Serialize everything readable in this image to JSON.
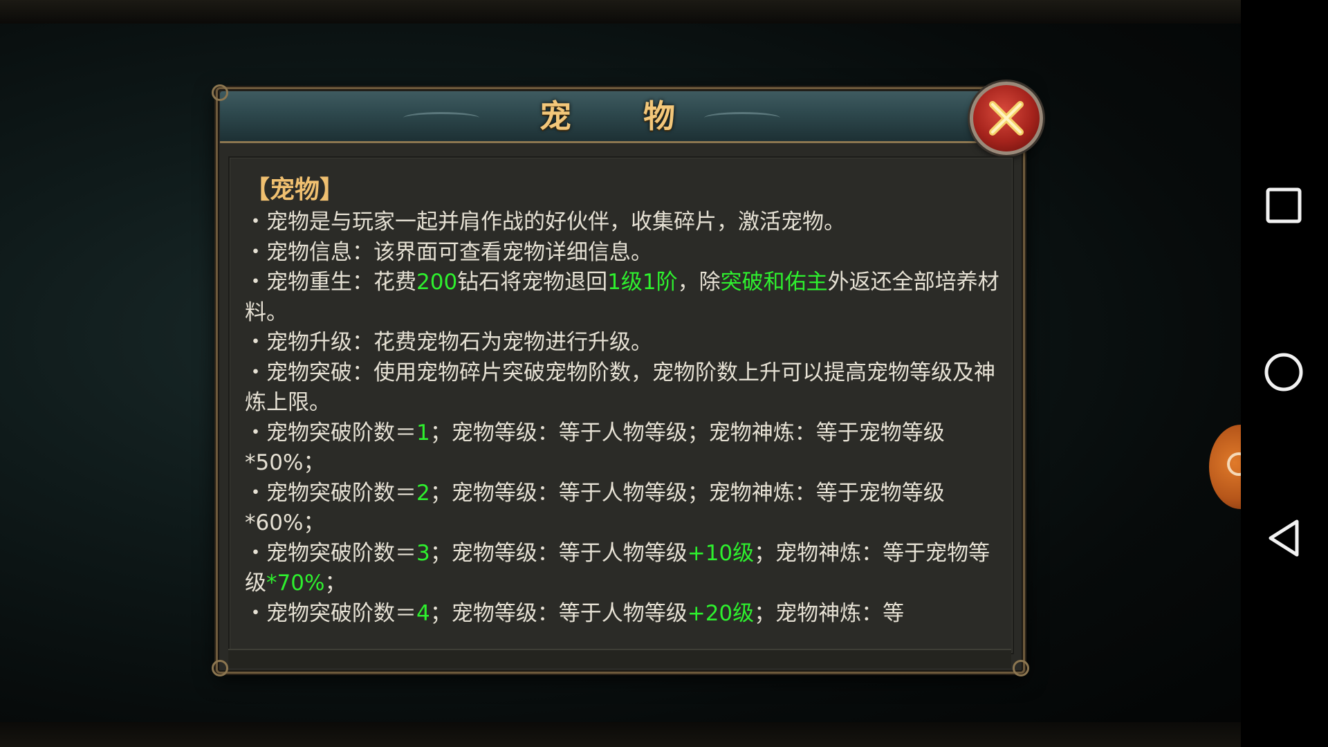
{
  "dialog": {
    "title": "宠  物",
    "close_label": "close",
    "section_title": "【宠物】",
    "lines": [
      [
        {
          "t": "・宠物是与玩家一起并肩作战的好伙伴，收集碎片，激活宠物。"
        }
      ],
      [
        {
          "t": "・宠物信息：该界面可查看宠物详细信息。"
        }
      ],
      [
        {
          "t": "・宠物重生：花费"
        },
        {
          "t": "200",
          "hl": true
        },
        {
          "t": "钻石将宠物退回"
        },
        {
          "t": "1级1阶",
          "hl": true
        },
        {
          "t": "，除"
        },
        {
          "t": "突破和佑主",
          "hl": true
        },
        {
          "t": "外返还全部培养材料。"
        }
      ],
      [
        {
          "t": "・宠物升级：花费宠物石为宠物进行升级。"
        }
      ],
      [
        {
          "t": "・宠物突破：使用宠物碎片突破宠物阶数，宠物阶数上升可以提高宠物等级及神炼上限。"
        }
      ],
      [
        {
          "t": "・宠物突破阶数＝"
        },
        {
          "t": "1",
          "hl": true
        },
        {
          "t": "；宠物等级：等于人物等级；宠物神炼：等于宠物等级*50%；"
        }
      ],
      [
        {
          "t": "・宠物突破阶数＝"
        },
        {
          "t": "2",
          "hl": true
        },
        {
          "t": "；宠物等级：等于人物等级；宠物神炼：等于宠物等级*60%；"
        }
      ],
      [
        {
          "t": "・宠物突破阶数＝"
        },
        {
          "t": "3",
          "hl": true
        },
        {
          "t": "；宠物等级：等于人物等级"
        },
        {
          "t": "+10级",
          "hl": true
        },
        {
          "t": "；宠物神炼：等于宠物等级"
        },
        {
          "t": "*70%",
          "hl": true
        },
        {
          "t": "；"
        }
      ],
      [
        {
          "t": "・宠物突破阶数＝"
        },
        {
          "t": "4",
          "hl": true
        },
        {
          "t": "；宠物等级：等于人物等级"
        },
        {
          "t": "+20级",
          "hl": true
        },
        {
          "t": "；宠物神炼：等"
        }
      ]
    ]
  },
  "colors": {
    "highlight": "#2ef02e",
    "body_text": "#e6e1d4",
    "title_gold": "#f3c77a"
  },
  "navbar": {
    "buttons": [
      "recent-apps",
      "home",
      "back"
    ]
  }
}
